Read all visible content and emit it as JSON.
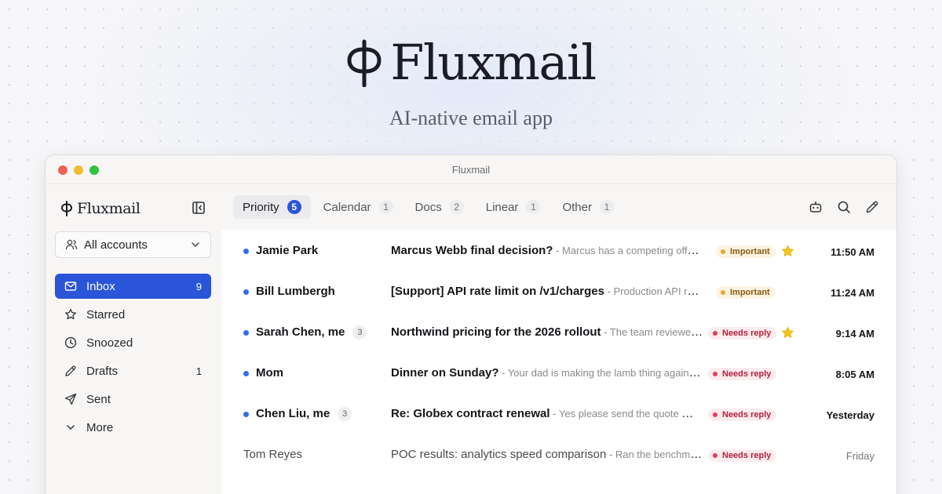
{
  "hero": {
    "title": "Fluxmail",
    "tagline": "AI-native email app"
  },
  "window": {
    "title": "Fluxmail"
  },
  "sidebar": {
    "brand": "Fluxmail",
    "accounts_label": "All accounts",
    "items": [
      {
        "label": "Inbox",
        "count": "9",
        "icon": "inbox-icon"
      },
      {
        "label": "Starred",
        "count": "",
        "icon": "star-icon"
      },
      {
        "label": "Snoozed",
        "count": "",
        "icon": "clock-icon"
      },
      {
        "label": "Drafts",
        "count": "1",
        "icon": "pencil-icon"
      },
      {
        "label": "Sent",
        "count": "",
        "icon": "send-icon"
      },
      {
        "label": "More",
        "count": "",
        "icon": "chevron-down-icon"
      }
    ]
  },
  "tabs": [
    {
      "label": "Priority",
      "count": "5"
    },
    {
      "label": "Calendar",
      "count": "1"
    },
    {
      "label": "Docs",
      "count": "2"
    },
    {
      "label": "Linear",
      "count": "1"
    },
    {
      "label": "Other",
      "count": "1"
    }
  ],
  "emails": [
    {
      "sender": "Jamie Park",
      "thread": "",
      "subject": "Marcus Webb final decision?",
      "snippet": " - Marcus has a competing offer expiring Friday and needs an answer",
      "badge": "Important",
      "starred": true,
      "time": "11:50 AM",
      "unread": true
    },
    {
      "sender": "Bill Lumbergh",
      "thread": "",
      "subject": "[Support] API rate limit on /v1/charges",
      "snippet": " - Production API rate limit was exceeded",
      "badge": "Important",
      "starred": false,
      "time": "11:24 AM",
      "unread": true
    },
    {
      "sender": "Sarah Chen, me",
      "thread": "3",
      "subject": "Northwind pricing for the 2026 rollout",
      "snippet": " - The team reviewed the proposal",
      "badge": "Needs reply",
      "starred": true,
      "time": "9:14 AM",
      "unread": true
    },
    {
      "sender": "Mom",
      "thread": "",
      "subject": "Dinner on Sunday?",
      "snippet": " - Your dad is making the lamb thing again. Let me know",
      "badge": "Needs reply",
      "starred": false,
      "time": "8:05 AM",
      "unread": true
    },
    {
      "sender": "Chen Liu, me",
      "thread": "3",
      "subject": "Re: Globex contract renewal",
      "snippet": " - Yes please send the quote — we need it by",
      "badge": "Needs reply",
      "starred": false,
      "time": "Yesterday",
      "unread": true
    },
    {
      "sender": "Tom Reyes",
      "thread": "",
      "subject": "POC results: analytics speed comparison",
      "snippet": " - Ran the benchmarks",
      "badge": "Needs reply",
      "starred": false,
      "time": "Friday",
      "unread": false
    }
  ],
  "colors": {
    "accent": "#2a55d8",
    "unread_dot": "#2f6fe8",
    "important": "#f0a330",
    "needs_reply": "#ea3b5c",
    "star": "#f5c518"
  }
}
